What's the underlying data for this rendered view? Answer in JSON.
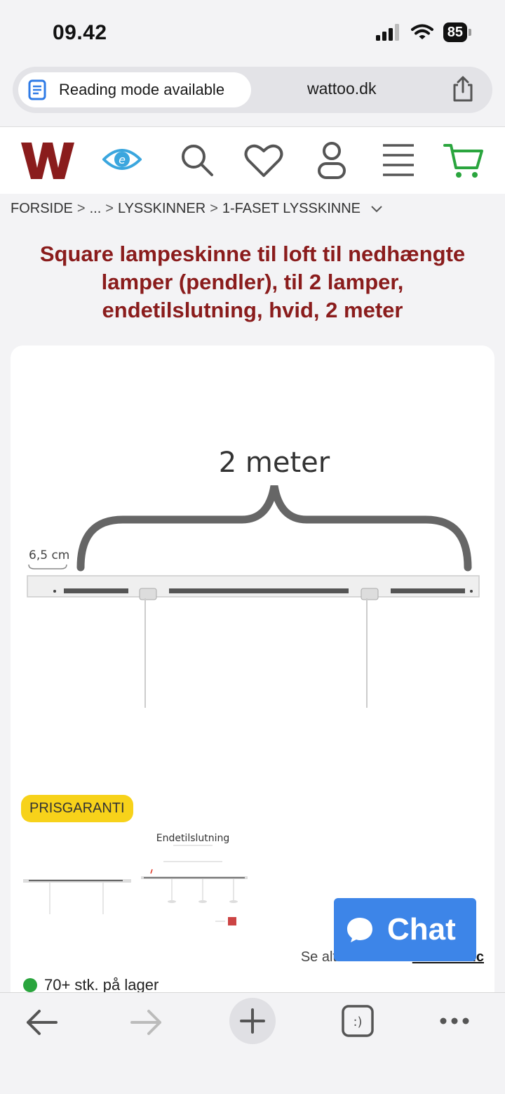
{
  "status_bar": {
    "time": "09.42",
    "battery": "85"
  },
  "url_bar": {
    "reading_mode": "Reading mode available",
    "domain": "wattoo.dk"
  },
  "header": {
    "icons": [
      "wattoo-logo",
      "eye-icon",
      "search-icon",
      "heart-icon",
      "user-icon",
      "menu-icon",
      "cart-icon"
    ],
    "logo_letter": "W",
    "brand_color": "#8a1c1c",
    "accent_color": "#2aa53e"
  },
  "breadcrumb": {
    "items": [
      "FORSIDE",
      "...",
      "LYSSKINNER",
      "1-FASET LYSSKINNE"
    ],
    "separator": ">"
  },
  "product": {
    "title": "Square lampeskinne til loft til nedhængte lamper (pendler), til 2 lamper, endetilslutning, hvid, 2 meter",
    "image_labels": {
      "length": "2 meter",
      "offset": "6,5 cm"
    },
    "badge": "PRISGARANTI",
    "thumbnail_title": "Endetilslutning",
    "see_all_prefix": "Se alt fra mærket",
    "brand": "Nordtronic",
    "stock": "70+ stk. på lager"
  },
  "chat": {
    "label": "Chat",
    "color": "#3d85e8"
  },
  "toolbar": {
    "icons": [
      "back-arrow-icon",
      "forward-arrow-icon",
      "new-tab-icon",
      "tabs-icon",
      "more-icon"
    ],
    "tabs_label": ":)"
  }
}
